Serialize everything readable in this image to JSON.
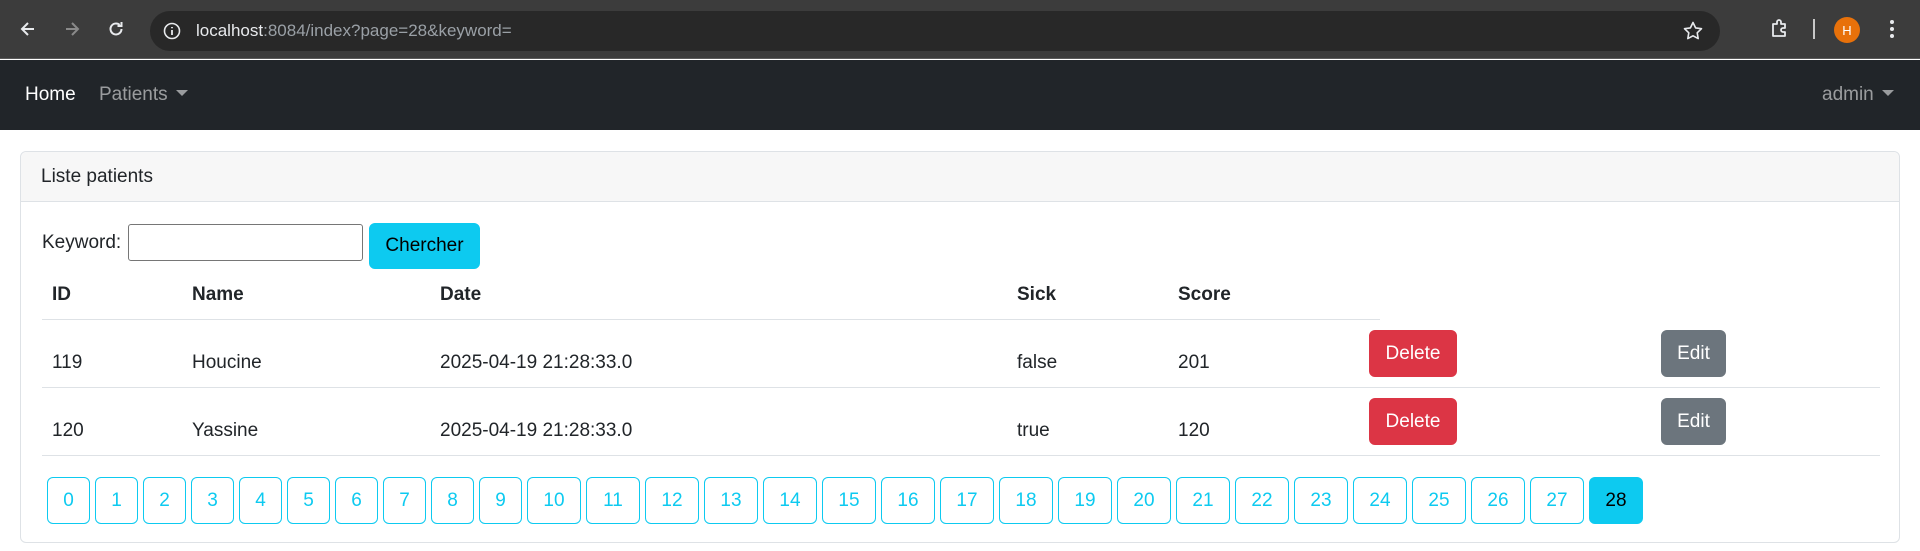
{
  "browser": {
    "url_host": "localhost",
    "url_rest": ":8084/index?page=28&keyword=",
    "profile_initial": "H"
  },
  "navbar": {
    "home": "Home",
    "patients": "Patients",
    "user": "admin"
  },
  "card": {
    "title": "Liste patients"
  },
  "search": {
    "label": "Keyword:",
    "value": "",
    "button": "Chercher"
  },
  "table": {
    "headers": [
      "ID",
      "Name",
      "Date",
      "Sick",
      "Score"
    ],
    "rows": [
      {
        "id": "119",
        "name": "Houcine",
        "date": "2025-04-19 21:28:33.0",
        "sick": "false",
        "score": "201",
        "delete": "Delete",
        "edit": "Edit"
      },
      {
        "id": "120",
        "name": "Yassine",
        "date": "2025-04-19 21:28:33.0",
        "sick": "true",
        "score": "120",
        "delete": "Delete",
        "edit": "Edit"
      }
    ]
  },
  "pagination": {
    "pages": [
      "0",
      "1",
      "2",
      "3",
      "4",
      "5",
      "6",
      "7",
      "8",
      "9",
      "10",
      "11",
      "12",
      "13",
      "14",
      "15",
      "16",
      "17",
      "18",
      "19",
      "20",
      "21",
      "22",
      "23",
      "24",
      "25",
      "26",
      "27",
      "28"
    ],
    "current": "28"
  },
  "colors": {
    "info": "#0dcaf0",
    "danger": "#dc3545",
    "secondary": "#6c757d",
    "navbar": "#212529"
  },
  "icons": {
    "back": "arrow-left-icon",
    "forward": "arrow-right-icon",
    "reload": "reload-icon",
    "site_info": "site-info-icon",
    "bookmark": "star-icon",
    "extensions": "puzzle-icon",
    "menu": "vertical-dots-icon"
  }
}
